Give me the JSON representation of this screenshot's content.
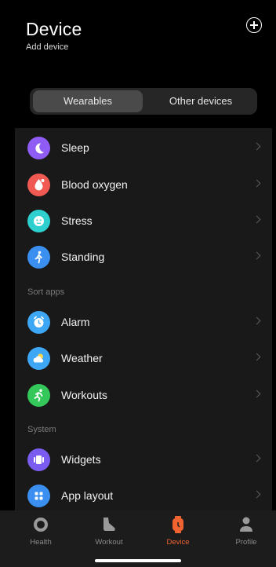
{
  "header": {
    "title": "Device",
    "subtitle": "Add device",
    "add_icon": "plus-circle-icon"
  },
  "segment": {
    "options": [
      "Wearables",
      "Other devices"
    ],
    "selected": "Wearables"
  },
  "list": {
    "items": [
      {
        "label": "Sleep",
        "icon": "moon-icon",
        "color": "#8f5cf6"
      },
      {
        "label": "Blood oxygen",
        "icon": "blood-drop-icon",
        "color": "#f05a52"
      },
      {
        "label": "Stress",
        "icon": "stress-face-icon",
        "color": "#2ecfcf"
      },
      {
        "label": "Standing",
        "icon": "standing-person-icon",
        "color": "#3b8ff0"
      }
    ],
    "sort_apps_label": "Sort apps",
    "sort_apps": [
      {
        "label": "Alarm",
        "icon": "alarm-clock-icon",
        "color": "#3ea7f5"
      },
      {
        "label": "Weather",
        "icon": "weather-icon",
        "color": "#3ea7f5"
      },
      {
        "label": "Workouts",
        "icon": "running-icon",
        "color": "#34c759"
      }
    ],
    "system_label": "System",
    "system": [
      {
        "label": "Widgets",
        "icon": "widgets-icon",
        "color": "#7b5cf0"
      },
      {
        "label": "App layout",
        "icon": "grid-icon",
        "color": "#3b8ff0"
      }
    ]
  },
  "tabbar": {
    "tabs": [
      {
        "label": "Health",
        "icon": "health-ring-icon"
      },
      {
        "label": "Workout",
        "icon": "shoe-icon"
      },
      {
        "label": "Device",
        "icon": "watch-icon"
      },
      {
        "label": "Profile",
        "icon": "person-icon"
      }
    ],
    "active": "Device",
    "active_color": "#f0622f"
  }
}
